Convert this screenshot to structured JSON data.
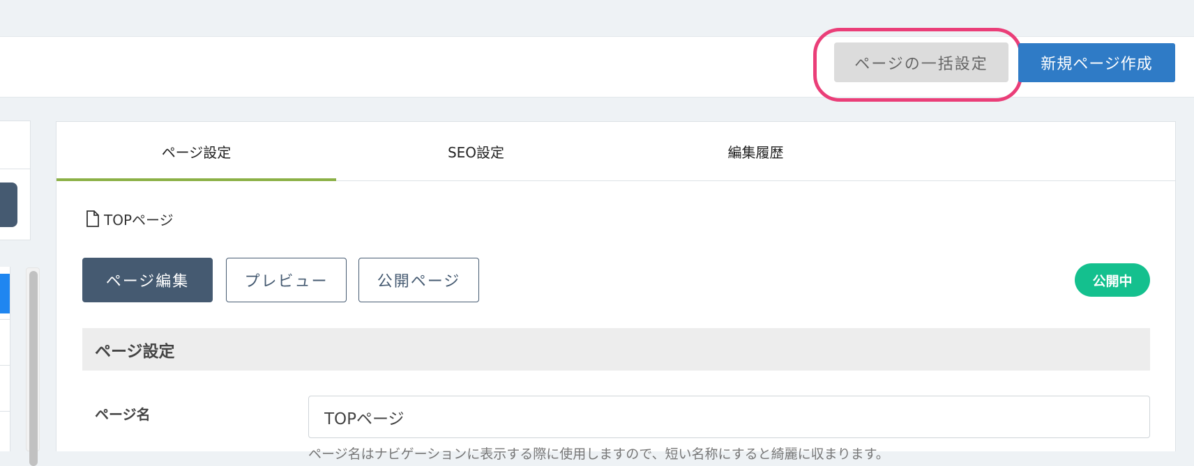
{
  "header": {
    "bulk_settings_label": "ページの一括設定",
    "new_page_label": "新規ページ作成"
  },
  "tabs": [
    {
      "label": "ページ設定",
      "active": true
    },
    {
      "label": "SEO設定",
      "active": false
    },
    {
      "label": "編集履歴",
      "active": false
    }
  ],
  "breadcrumb": {
    "icon": "file-icon",
    "label": "TOPページ"
  },
  "actions": {
    "edit_label": "ページ編集",
    "preview_label": "プレビュー",
    "public_label": "公開ページ"
  },
  "status_badge": "公開中",
  "section": {
    "title": "ページ設定"
  },
  "form": {
    "page_name_label": "ページ名",
    "page_name_value": "TOPページ",
    "page_name_help": "ページ名はナビゲーションに表示する際に使用しますので、短い名称にすると綺麗に収まります。"
  },
  "colors": {
    "primary": "#2f7bc6",
    "dark": "#455a71",
    "status_green": "#14c08e",
    "tab_active": "#8bb046",
    "highlight": "#ea3e78"
  }
}
